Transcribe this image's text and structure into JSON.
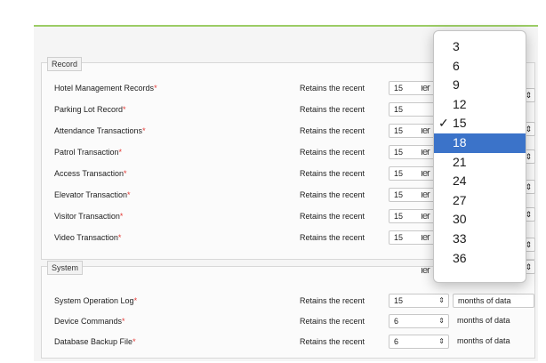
{
  "record_group": {
    "title": "Record",
    "rows": [
      {
        "label": "Hotel Management Records",
        "retain": "Retains the recent",
        "value": "15"
      },
      {
        "label": "Parking Lot Record",
        "retain": "Retains the recent",
        "value": "15"
      },
      {
        "label": "Attendance Transactions",
        "retain": "Retains the recent",
        "value": "15"
      },
      {
        "label": "Patrol Transaction",
        "retain": "Retains the recent",
        "value": "15"
      },
      {
        "label": "Access Transaction",
        "retain": "Retains the recent",
        "value": "15"
      },
      {
        "label": "Elevator Transaction",
        "retain": "Retains the recent",
        "value": "15"
      },
      {
        "label": "Visitor Transaction",
        "retain": "Retains the recent",
        "value": "15"
      },
      {
        "label": "Video Transaction",
        "retain": "Retains the recent",
        "value": "15"
      }
    ],
    "peek_suffix": "ıer"
  },
  "system_group": {
    "title": "System",
    "rows": [
      {
        "label": "System Operation Log",
        "retain": "Retains the recent",
        "value": "15",
        "unit": "months of data"
      },
      {
        "label": "Device Commands",
        "retain": "Retains the recent",
        "value": "6",
        "unit": "months of data"
      },
      {
        "label": "Database Backup File",
        "retain": "Retains the recent",
        "value": "6",
        "unit": "months of data"
      }
    ]
  },
  "required_marker": "*",
  "select_arrow": "⇕",
  "dropdown": {
    "options": [
      "3",
      "6",
      "9",
      "12",
      "15",
      "18",
      "21",
      "24",
      "27",
      "30",
      "33",
      "36"
    ],
    "checked": "15",
    "highlighted": "18",
    "check_glyph": "✓"
  }
}
